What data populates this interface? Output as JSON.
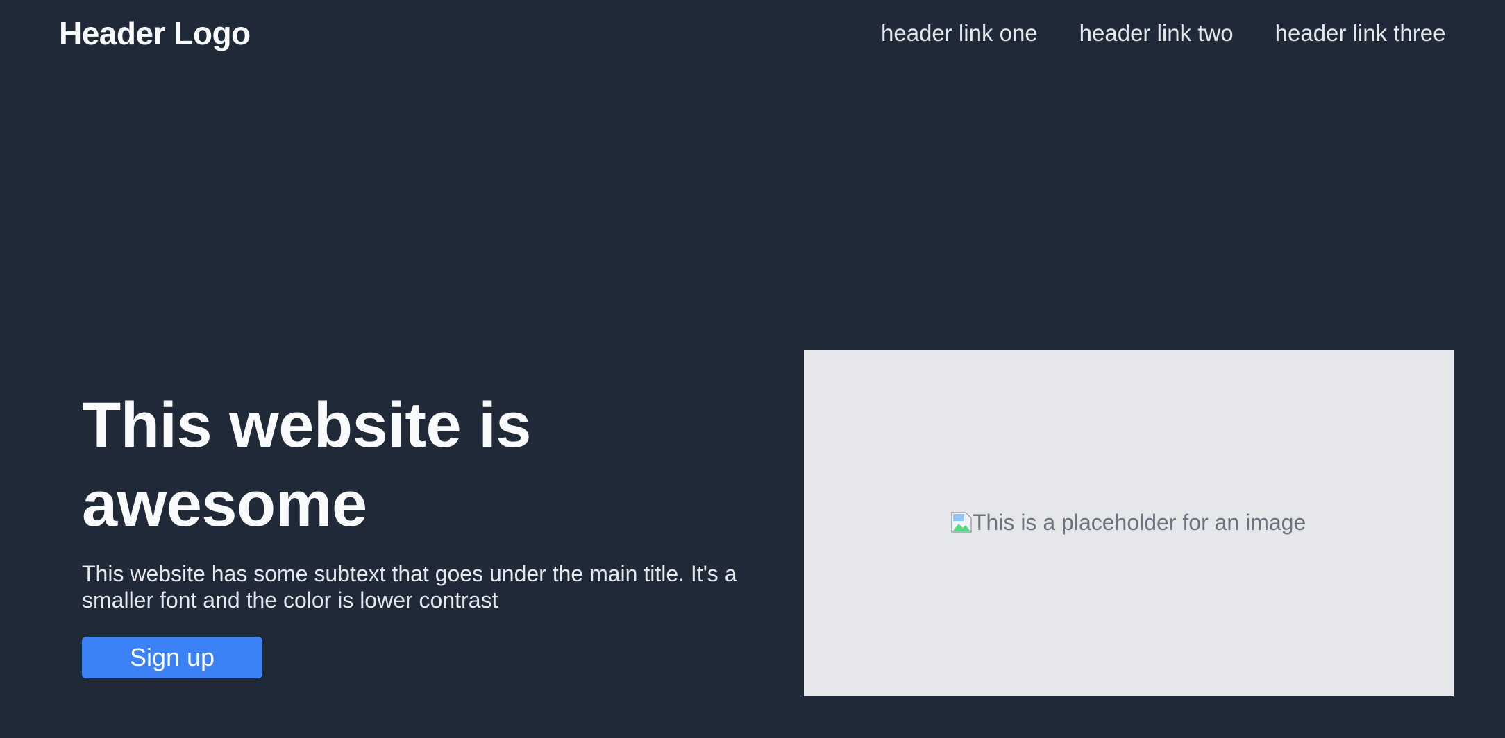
{
  "header": {
    "logo": "Header Logo",
    "links": [
      "header link one",
      "header link two",
      "header link three"
    ]
  },
  "hero": {
    "title": "This website is awesome",
    "subtext": "This website has some subtext that goes under the main title. It's a smaller font and the color is lower contrast",
    "button_label": "Sign up"
  },
  "image": {
    "alt_text": "This is a placeholder for an image",
    "icon": "broken-image-icon"
  },
  "colors": {
    "background": "#1f2937",
    "accent": "#3b82f6",
    "image_box": "#e5e7eb"
  }
}
